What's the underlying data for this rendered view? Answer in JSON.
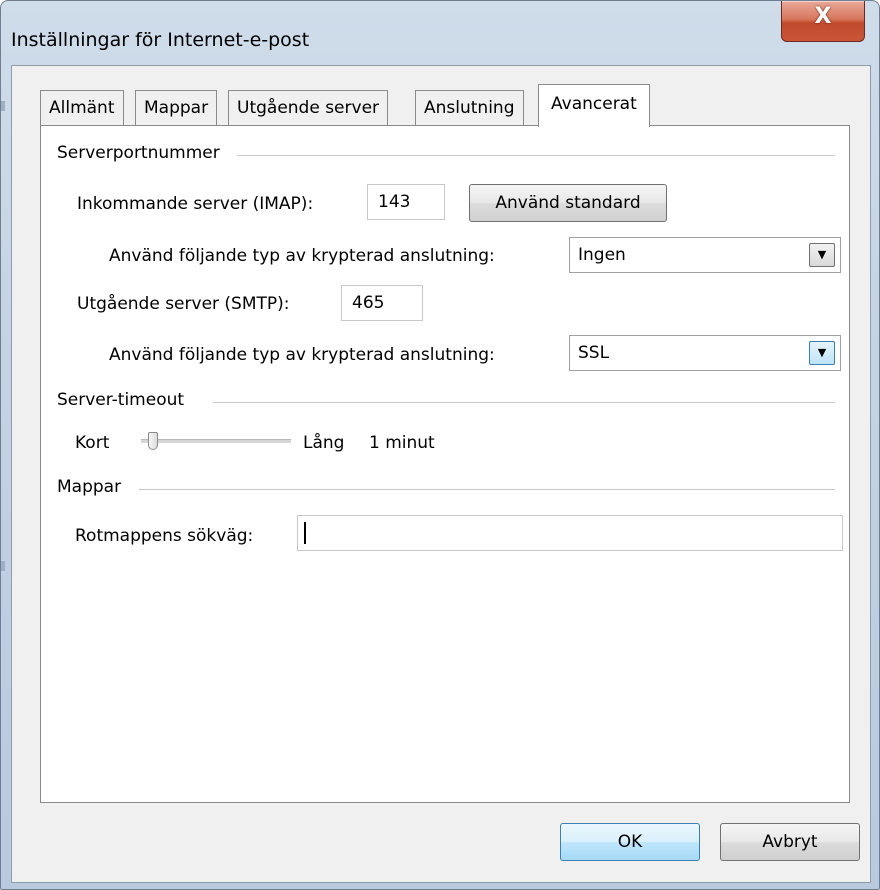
{
  "window": {
    "title": "Inställningar för Internet-e-post",
    "close_label": "X"
  },
  "tabs": [
    {
      "label": "Allmänt"
    },
    {
      "label": "Mappar"
    },
    {
      "label": "Utgående server"
    },
    {
      "label": "Anslutning"
    },
    {
      "label": "Avancerat",
      "active": true
    }
  ],
  "server_ports": {
    "group_label": "Serverportnummer",
    "incoming_label": "Inkommande server (IMAP):",
    "incoming_value": "143",
    "use_default_label": "Använd standard",
    "incoming_encryption_label": "Använd följande typ av krypterad anslutning:",
    "incoming_encryption_value": "Ingen",
    "outgoing_label": "Utgående server (SMTP):",
    "outgoing_value": "465",
    "outgoing_encryption_label": "Använd följande typ av krypterad anslutning:",
    "outgoing_encryption_value": "SSL"
  },
  "server_timeout": {
    "group_label": "Server-timeout",
    "short_label": "Kort",
    "long_label": "Lång",
    "value_text": "1 minut",
    "slider_fraction": 0.05
  },
  "folders": {
    "group_label": "Mappar",
    "root_path_label": "Rotmappens sökväg:",
    "root_path_value": ""
  },
  "buttons": {
    "ok_label": "OK",
    "cancel_label": "Avbryt"
  }
}
